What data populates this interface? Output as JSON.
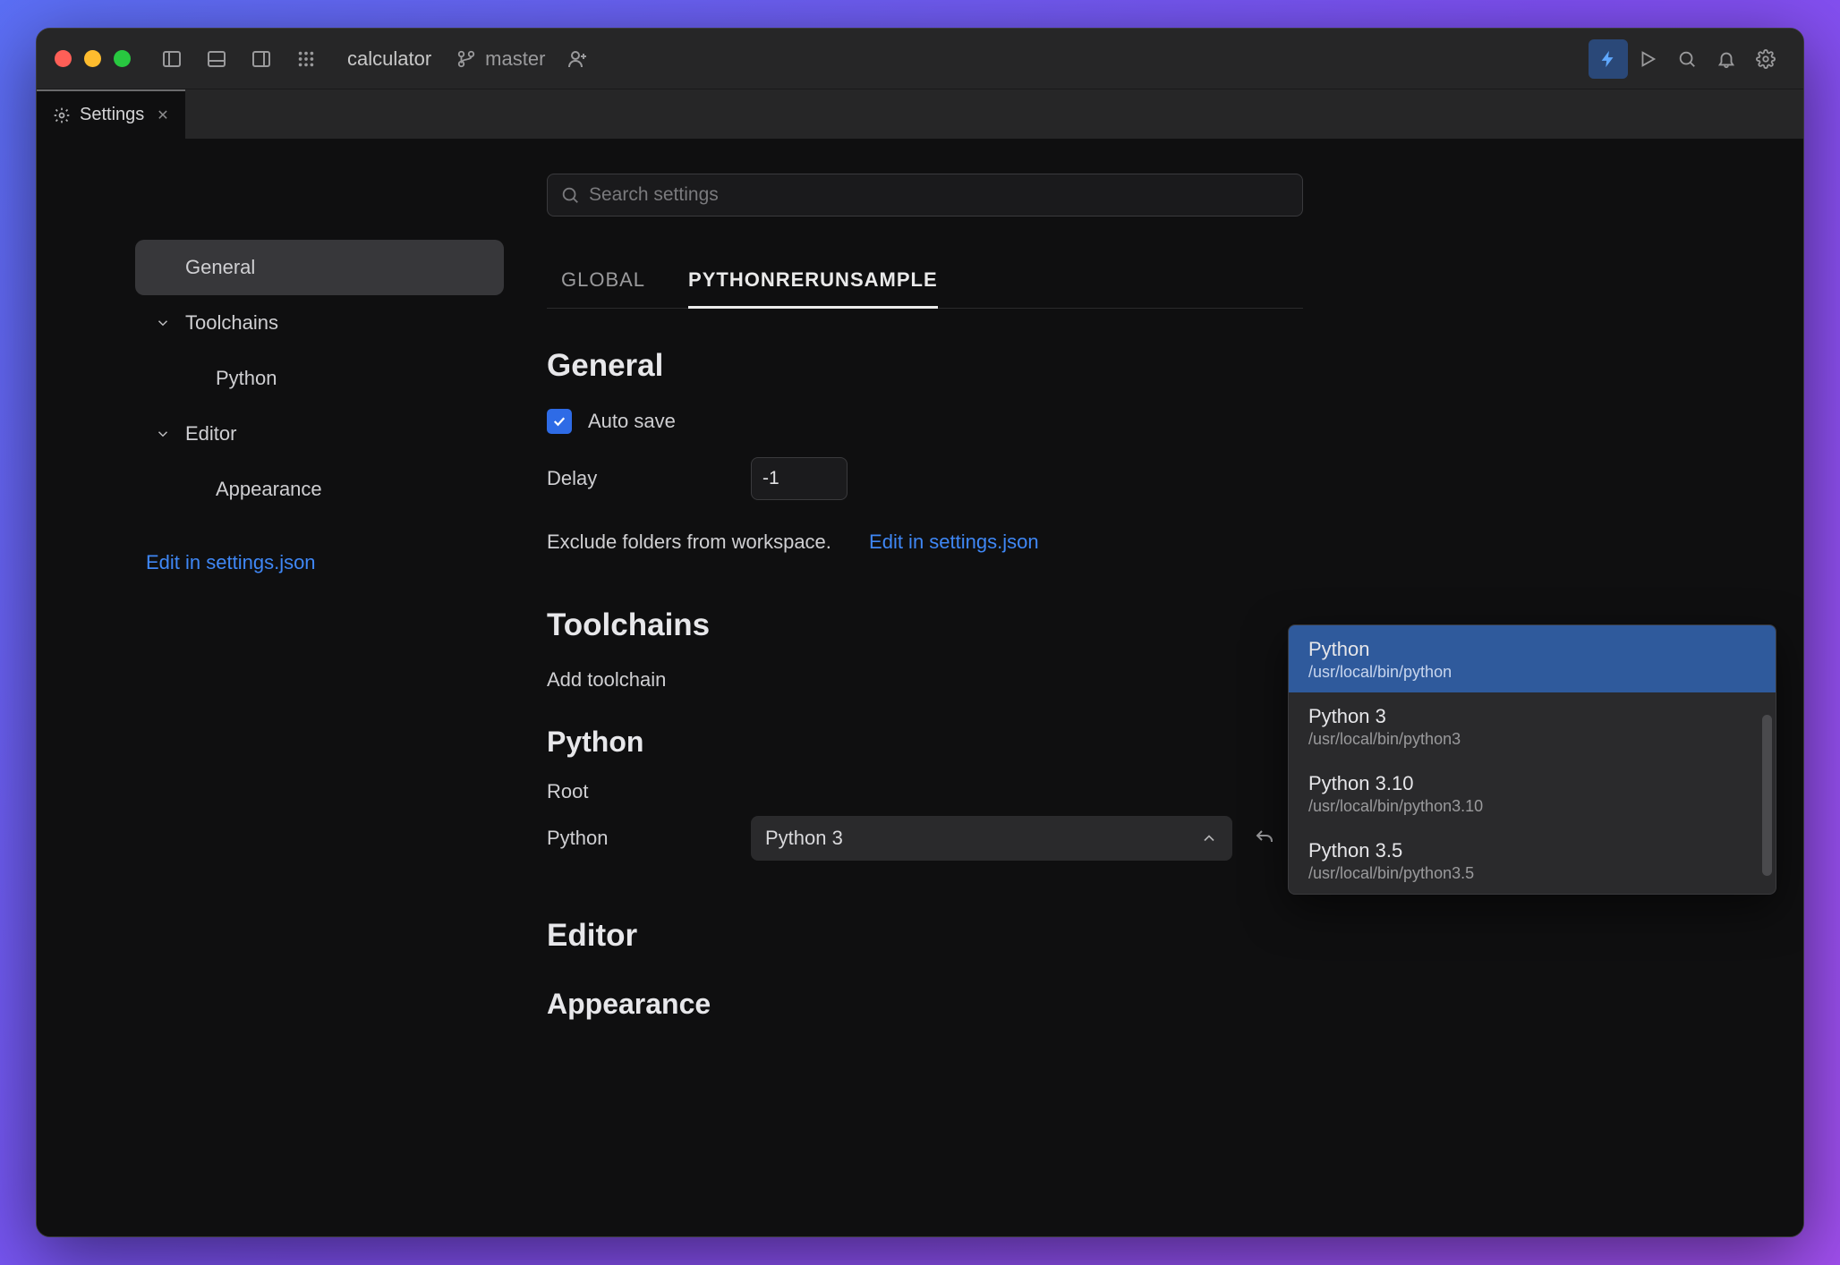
{
  "titlebar": {
    "project_name": "calculator",
    "branch": "master"
  },
  "tabs": [
    {
      "title": "Settings"
    }
  ],
  "sidebar": {
    "items": [
      {
        "label": "General",
        "active": true
      },
      {
        "label": "Toolchains",
        "chevron": true
      },
      {
        "label": "Python",
        "sub": true
      },
      {
        "label": "Editor",
        "chevron": true
      },
      {
        "label": "Appearance",
        "sub": true
      }
    ],
    "edit_link": "Edit in settings.json"
  },
  "search": {
    "placeholder": "Search settings"
  },
  "subtabs": {
    "global": "GLOBAL",
    "local": "PYTHONRERUNSAMPLE"
  },
  "sections": {
    "general": {
      "title": "General",
      "auto_save_label": "Auto save",
      "auto_save_checked": true,
      "delay_label": "Delay",
      "delay_value": "-1",
      "exclude_text": "Exclude folders from workspace.",
      "exclude_link": "Edit in settings.json"
    },
    "toolchains": {
      "title": "Toolchains",
      "add_toolchain_label": "Add toolchain",
      "python_title": "Python",
      "root_label": "Root",
      "python_label": "Python",
      "python_selected": "Python 3"
    },
    "editor": {
      "title": "Editor",
      "appearance_title": "Appearance"
    }
  },
  "dropdown": {
    "items": [
      {
        "name": "Python",
        "path": "/usr/local/bin/python",
        "selected": true
      },
      {
        "name": "Python 3",
        "path": "/usr/local/bin/python3"
      },
      {
        "name": "Python 3.10",
        "path": "/usr/local/bin/python3.10"
      },
      {
        "name": "Python 3.5",
        "path": "/usr/local/bin/python3.5"
      }
    ]
  }
}
